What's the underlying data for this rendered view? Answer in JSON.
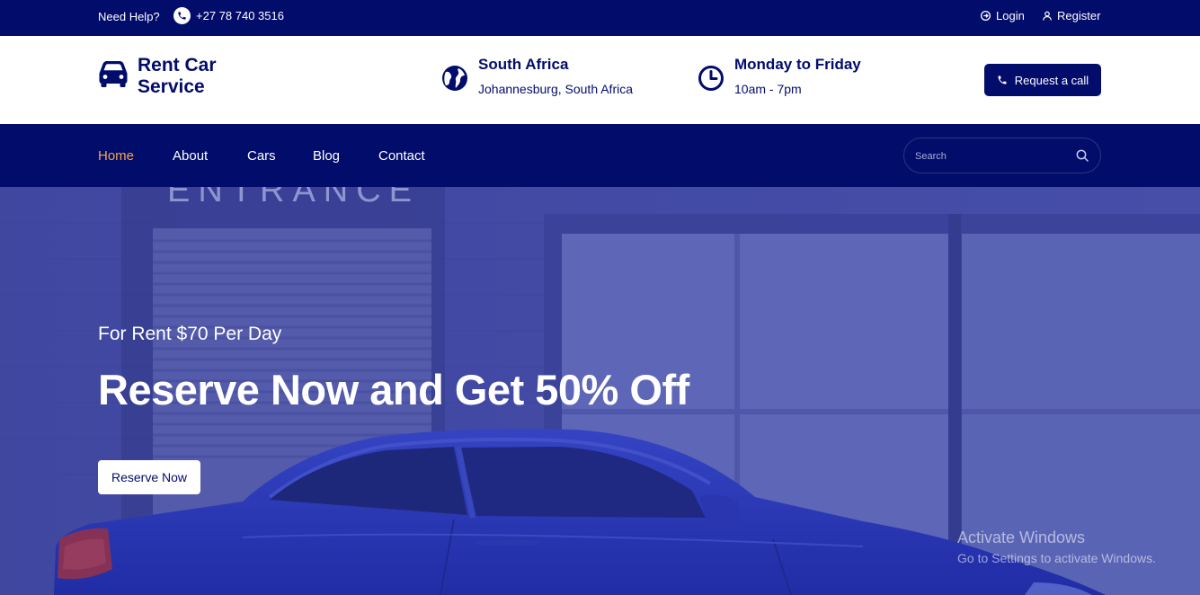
{
  "topbar": {
    "help_label": "Need Help?",
    "phone": "+27 78 740 3516",
    "login_label": "Login",
    "register_label": "Register"
  },
  "header": {
    "brand_line1": "Rent Car",
    "brand_line2": "Service",
    "location_title": "South Africa",
    "location_sub": "Johannesburg, South Africa",
    "hours_title": "Monday to Friday",
    "hours_sub": "10am - 7pm",
    "request_label": "Request a call"
  },
  "nav": {
    "items": [
      {
        "label": "Home",
        "active": true
      },
      {
        "label": "About"
      },
      {
        "label": "Cars"
      },
      {
        "label": "Blog"
      },
      {
        "label": "Contact"
      }
    ],
    "search_placeholder": "Search"
  },
  "hero": {
    "tagline": "For Rent $70 Per Day",
    "headline": "Reserve Now and Get 50% Off",
    "cta_label": "Reserve Now",
    "sign_text": "ENTRANCE"
  },
  "os_watermark": {
    "line1": "Activate Windows",
    "line2": "Go to Settings to activate Windows."
  },
  "colors": {
    "primary": "#020c6b",
    "accent": "#f6a64a",
    "hero_tint": "#3a43a8"
  },
  "icons": [
    "phone-icon",
    "login-icon",
    "user-icon",
    "car-icon",
    "globe-icon",
    "clock-icon",
    "search-icon"
  ]
}
